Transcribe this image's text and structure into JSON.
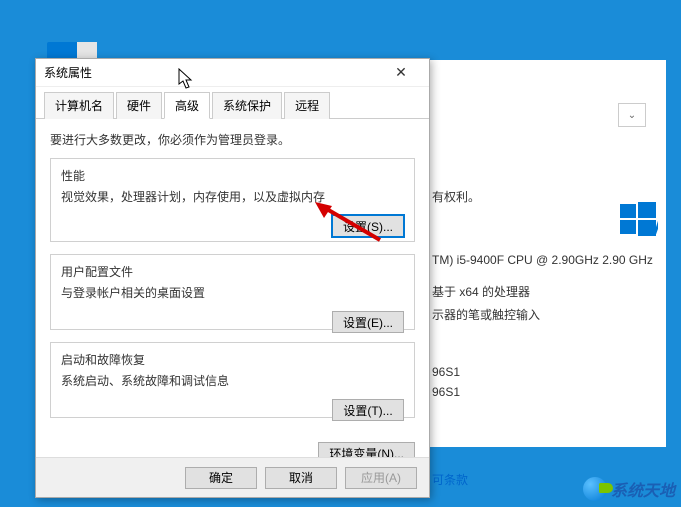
{
  "dialog": {
    "title": "系统属性",
    "close": "✕",
    "tabs": [
      "计算机名",
      "硬件",
      "高级",
      "系统保护",
      "远程"
    ],
    "active_tab": 2,
    "intro": "要进行大多数更改，你必须作为管理员登录。",
    "groups": {
      "performance": {
        "title": "性能",
        "desc": "视觉效果，处理器计划，内存使用，以及虚拟内存",
        "button": "设置(S)..."
      },
      "userprofile": {
        "title": "用户配置文件",
        "desc": "与登录帐户相关的桌面设置",
        "button": "设置(E)..."
      },
      "startup": {
        "title": "启动和故障恢复",
        "desc": "系统启动、系统故障和调试信息",
        "button": "设置(T)..."
      }
    },
    "env_button": "环境变量(N)...",
    "buttons": {
      "ok": "确定",
      "cancel": "取消",
      "apply": "应用(A)"
    }
  },
  "background": {
    "rights": "有权利。",
    "cpu": "TM) i5-9400F CPU @ 2.90GHz   2.90 GHz",
    "arch": "基于 x64 的处理器",
    "pen": "示器的笔或触控输入",
    "code1": "96S1",
    "code2": "96S1",
    "link": "可条款",
    "dropdown_glyph": "⌄"
  },
  "watermark": {
    "text": "系统天地"
  }
}
